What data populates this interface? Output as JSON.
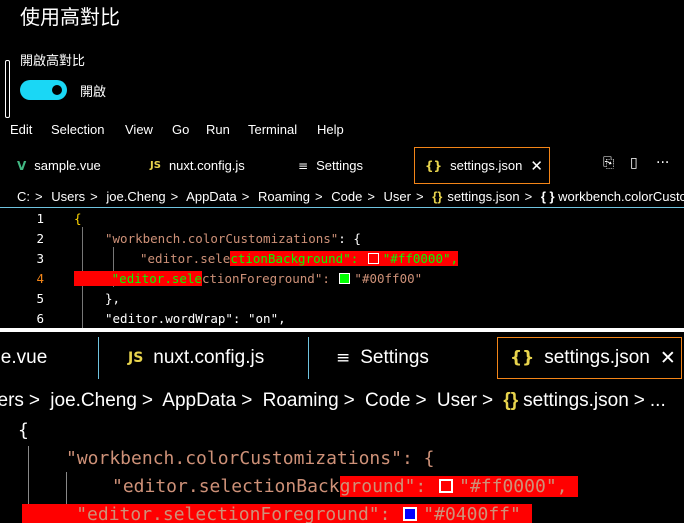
{
  "high_contrast": {
    "title": "使用高對比",
    "toggle_label": "開啟高對比",
    "toggle_state": "開啟",
    "toggle_on": true,
    "accent_color": "#1ad7f5"
  },
  "menubar": [
    "Edit",
    "Selection",
    "View",
    "Go",
    "Run",
    "Terminal",
    "Help"
  ],
  "tabs": [
    {
      "label": "sample.vue",
      "icon": "vue-icon",
      "glyph": "V"
    },
    {
      "label": "nuxt.config.js",
      "icon": "js-icon",
      "glyph": "JS"
    },
    {
      "label": "Settings",
      "icon": "settings-lines-icon",
      "glyph": "≡"
    },
    {
      "label": "settings.json",
      "icon": "json-braces-icon",
      "glyph": "{}",
      "active": true
    }
  ],
  "tab_close_glyph": "✕",
  "tab_actions": {
    "split_glyph": "▯",
    "more_glyph": "···"
  },
  "breadcrumb1": {
    "items": [
      "C:",
      "Users",
      "joe.Cheng",
      "AppData",
      "Roaming",
      "Code",
      "User"
    ],
    "file": "settings.json",
    "symbol": "workbench.colorCusto",
    "separator": ">"
  },
  "breadcrumb2": {
    "items": [
      "sers",
      "joe.Cheng",
      "AppData",
      "Roaming",
      "Code",
      "User"
    ],
    "file": "settings.json",
    "trail": "..."
  },
  "code1": {
    "line_numbers": [
      "1",
      "2",
      "3",
      "4",
      "5",
      "6"
    ],
    "l1": "{",
    "l2_key": "\"workbench.colorCustomizations\"",
    "l2_rest": ": {",
    "l3_a": "\"editor.sele",
    "l3_b": "ctionBackground\": ",
    "l3_val": "\"#ff0000\",",
    "l4_a": "\"editor.sele",
    "l4_b": "ctionForeground\": ",
    "l4_val": "\"#00ff00\"",
    "l5": "},",
    "l6": "\"editor.wordWrap\": \"on\","
  },
  "code2": {
    "l1": "{",
    "l2": "\"workbench.colorCustomizations\": {",
    "l3_a": "\"editor.selectionBack",
    "l3_b": "ground\": ",
    "l3_val": "\"#ff0000\",",
    "l4_a": "\"editor.selectionForeground\": ",
    "l4_val": "\"#0400ff\""
  },
  "colors": {
    "selection_bg": "#ff0000",
    "swatch_red": "#ff0000",
    "swatch_green": "#00ff00",
    "swatch_blue": "#0400ff",
    "tab_border": "#f38518"
  }
}
